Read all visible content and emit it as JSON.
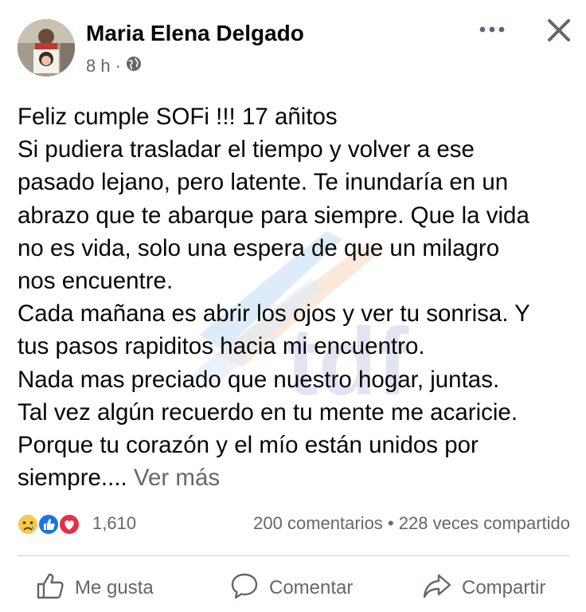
{
  "post": {
    "author": "Maria Elena Delgado",
    "time": "8 h",
    "separator": "·",
    "privacy_icon": "globe-icon",
    "more_icon": "more-dots-icon",
    "close_icon": "close-icon",
    "lines": [
      "Feliz cumple SOFi !!! 17 añitos",
      "Si pudiera trasladar el tiempo y volver a ese",
      "pasado lejano, pero latente. Te inundaría en un",
      "abrazo que te abarque para siempre. Que la vida",
      "no es vida, solo una espera de que un milagro",
      "nos encuentre.",
      "Cada mañana es abrir los ojos y ver tu sonrisa. Y",
      "tus pasos rapiditos hacia mi encuentro.",
      "Nada mas preciado que nuestro hogar, juntas.",
      "Tal vez algún recuerdo en tu mente me acaricie.",
      "Porque tu corazón y el mío están unidos por",
      "siempre...."
    ],
    "see_more": "Ver más"
  },
  "watermark": {
    "text": "tdf",
    "colors": [
      "#7fb6e8",
      "#f2b48a",
      "#b9bde0"
    ]
  },
  "stats": {
    "reaction_icons": [
      "sad-reaction-icon",
      "like-reaction-icon",
      "love-reaction-icon"
    ],
    "reaction_count": "1,610",
    "comments": "200 comentarios",
    "dot": "•",
    "shares": "228 veces compartido"
  },
  "actions": {
    "like": "Me gusta",
    "comment": "Comentar",
    "share": "Compartir"
  }
}
